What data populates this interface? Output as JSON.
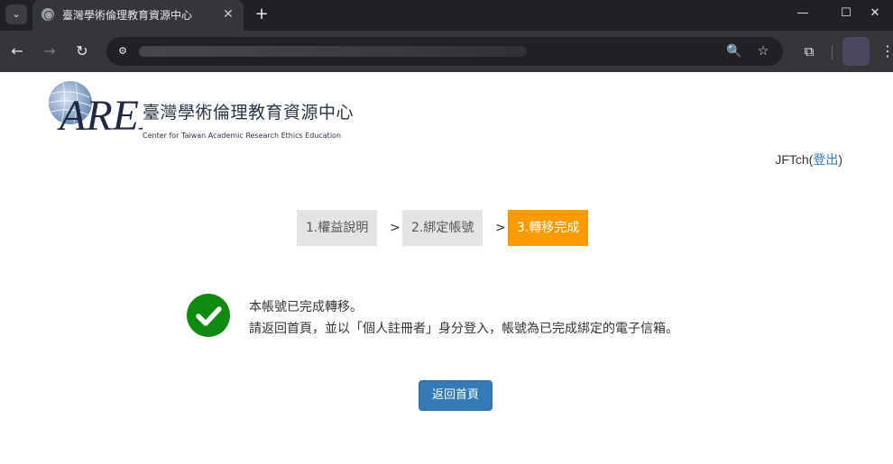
{
  "browser": {
    "tab_title": "臺灣學術倫理教育資源中心",
    "tab_close_glyph": "✕",
    "new_tab_glyph": "+",
    "tab_menu_glyph": "⌄",
    "window_controls": {
      "minimize": "—",
      "maximize": "☐",
      "close": "✕"
    },
    "nav": {
      "back": "←",
      "forward": "→",
      "reload": "↻"
    },
    "omnibox_icons": {
      "site_info": "⚙",
      "zoom": "🔍",
      "bookmark": "☆"
    },
    "extensions_glyph": "⧉",
    "menu_glyph": "⋮"
  },
  "logo": {
    "mark_text": "AREE",
    "title": "臺灣學術倫理教育資源中心",
    "subtitle": "Center for Taiwan Academic Research Ethics Education"
  },
  "user": {
    "name": "JFTch",
    "open_paren": "(",
    "logout": "登出",
    "close_paren": ")"
  },
  "steps": [
    {
      "label": "1.權益說明",
      "state": "done"
    },
    {
      "label": "2.綁定帳號",
      "state": "done"
    },
    {
      "label": "3.轉移完成",
      "state": "active"
    }
  ],
  "step_separator": ">",
  "message": {
    "line1": "本帳號已完成轉移。",
    "line2": "請返回首頁，並以「個人註冊者」身分登入，帳號為已完成綁定的電子信箱。"
  },
  "home_button": "返回首頁",
  "colors": {
    "step_active": "#fb9b00",
    "step_inactive": "#e4e4e4",
    "success": "#0f8a0f",
    "primary_button": "#337ab7",
    "link": "#337ab7"
  }
}
